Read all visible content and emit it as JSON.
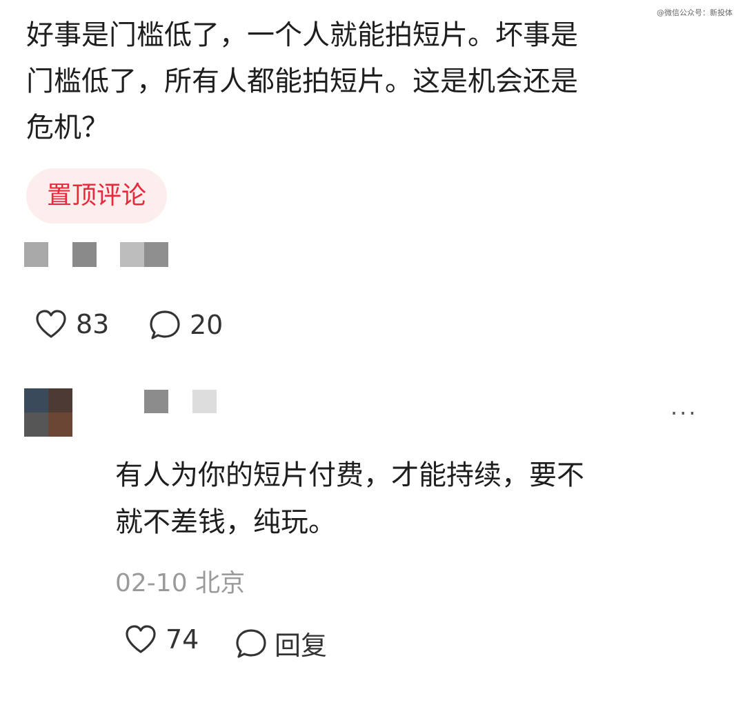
{
  "watermark": "@微信公众号：新投体",
  "post": {
    "lines": [
      "好事是门槛低了，一个人就能拍短片。坏事是",
      "门槛低了，所有人都能拍短片。这是机会还是",
      "危机？"
    ],
    "badge": "置顶评论",
    "likes": "83",
    "comments": "20"
  },
  "reply": {
    "more": "···",
    "lines": [
      "有人为你的短片付费，才能持续，要不",
      "就不差钱，纯玩。"
    ],
    "date": "02-10",
    "location": "北京",
    "likes": "74",
    "reply_label": "回复"
  },
  "colors": {
    "accent": "#e8293c",
    "badge_bg": "#fdeeee",
    "meta": "#9a9a9a",
    "text": "#1e1e1e"
  },
  "icons": [
    "heart-icon",
    "comment-icon",
    "more-icon"
  ]
}
